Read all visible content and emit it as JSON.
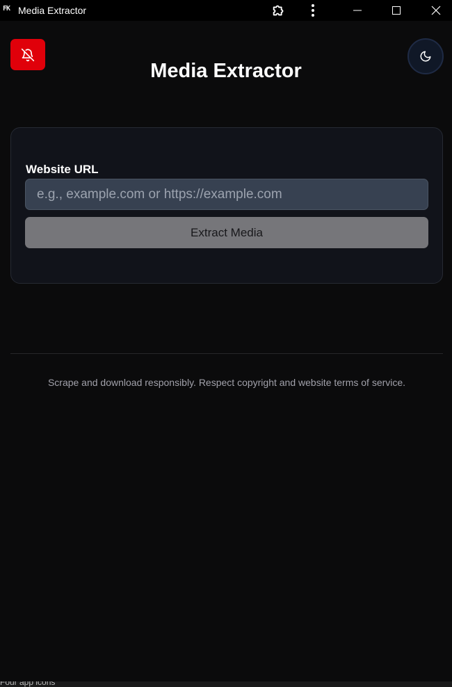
{
  "window": {
    "logo_text": "FK",
    "title": "Media Extractor"
  },
  "titlebar_icons": [
    "puzzle-icon",
    "kebab-menu-icon",
    "minimize-icon",
    "maximize-icon",
    "close-icon"
  ],
  "header": {
    "title": "Media Extractor",
    "mute_icon": "bell-off-icon",
    "mute_color": "#e0000a",
    "theme_icon": "moon-icon"
  },
  "form": {
    "label": "Website URL",
    "placeholder": "e.g., example.com or https://example.com",
    "value": "",
    "submit_label": "Extract Media"
  },
  "footer": {
    "note": "Scrape and download responsibly. Respect copyright and website terms of service."
  },
  "background_taskbar": {
    "partial_text": "Four app icons"
  }
}
